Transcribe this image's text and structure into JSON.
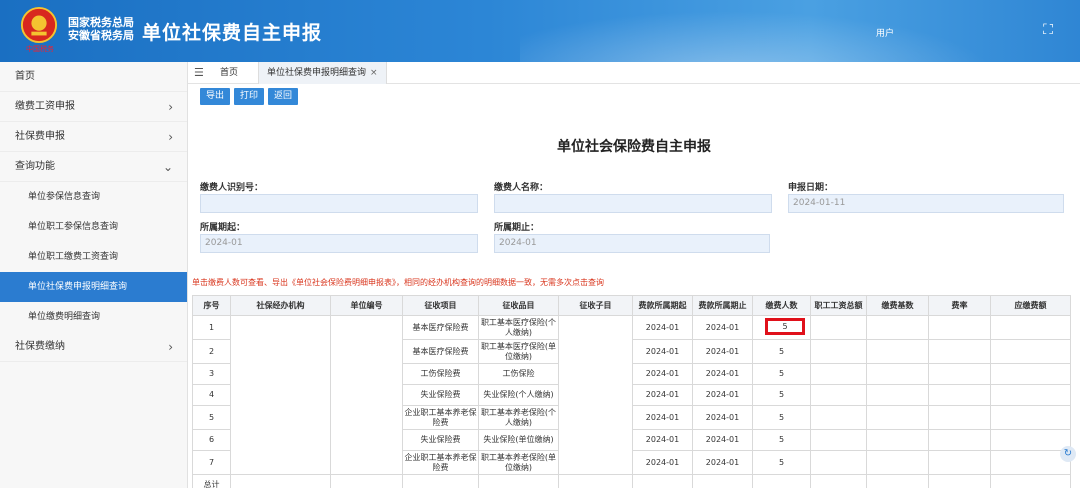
{
  "header": {
    "org_line1": "国家税务总局",
    "org_line2": "安徽省税务局",
    "app_title": "单位社保费自主申报",
    "user_label": "用户",
    "brand_color": "#1a6fc2"
  },
  "sidebar": {
    "items": [
      {
        "label": "首页"
      },
      {
        "label": "缴费工资申报",
        "chevron": "›"
      },
      {
        "label": "社保费申报",
        "chevron": "›"
      },
      {
        "label": "查询功能",
        "chevron": "⌄"
      }
    ],
    "sub_items": [
      {
        "label": "单位参保信息查询"
      },
      {
        "label": "单位职工参保信息查询"
      },
      {
        "label": "单位职工缴费工资查询"
      },
      {
        "label": "单位社保费申报明细查询",
        "active": true
      },
      {
        "label": "单位缴费明细查询"
      }
    ],
    "last_item": {
      "label": "社保费缴纳",
      "chevron": "›"
    },
    "active_color": "#2b7cd0"
  },
  "tabs": {
    "home": "首页",
    "current": "单位社保费申报明细查询",
    "close": "×"
  },
  "toolbar": {
    "export": "导出",
    "print": "打印",
    "back": "返回"
  },
  "main": {
    "title": "单位社会保险费自主申报",
    "form": {
      "payer_id_label": "缴费人识别号：",
      "payer_name_label": "缴费人名称：",
      "declare_date_label": "申报日期：",
      "declare_date_value": "2024-01-11",
      "period_start_label": "所属期起：",
      "period_start_value": "2024-01",
      "period_end_label": "所属期止：",
      "period_end_value": "2024-01"
    },
    "notice": "单击缴费人数可查看、导出《单位社会保险费明细申报表》，相同的经办机构查询的明细数据一致，无需多次点击查询"
  },
  "table": {
    "headers": [
      "序号",
      "社保经办机构",
      "单位编号",
      "征收项目",
      "征收品目",
      "征收子目",
      "费款所属期起",
      "费款所属期止",
      "缴费人数",
      "职工工资总额",
      "缴费基数",
      "费率",
      "应缴费额"
    ],
    "rows": [
      {
        "no": "1",
        "item": "基本医疗保险费",
        "sub": "职工基本医疗保险(个人缴纳)",
        "start": "2024-01",
        "end": "2024-01",
        "count": "5"
      },
      {
        "no": "2",
        "item": "基本医疗保险费",
        "sub": "职工基本医疗保险(单位缴纳)",
        "start": "2024-01",
        "end": "2024-01",
        "count": "5"
      },
      {
        "no": "3",
        "item": "工伤保险费",
        "sub": "工伤保险",
        "start": "2024-01",
        "end": "2024-01",
        "count": "5"
      },
      {
        "no": "4",
        "item": "失业保险费",
        "sub": "失业保险(个人缴纳)",
        "start": "2024-01",
        "end": "2024-01",
        "count": "5"
      },
      {
        "no": "5",
        "item": "企业职工基本养老保险费",
        "sub": "职工基本养老保险(个人缴纳)",
        "start": "2024-01",
        "end": "2024-01",
        "count": "5"
      },
      {
        "no": "6",
        "item": "失业保险费",
        "sub": "失业保险(单位缴纳)",
        "start": "2024-01",
        "end": "2024-01",
        "count": "5"
      },
      {
        "no": "7",
        "item": "企业职工基本养老保险费",
        "sub": "职工基本养老保险(单位缴纳)",
        "start": "2024-01",
        "end": "2024-01",
        "count": "5"
      }
    ],
    "total_label": "总计",
    "highlight_color": "#e0101a"
  }
}
